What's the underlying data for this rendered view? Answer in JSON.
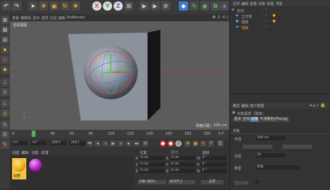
{
  "top_toolbar": {
    "axis_x": "X",
    "axis_y": "Y",
    "axis_z": "Z",
    "colors": {
      "accent": "#f5a623",
      "axis_x": "#e05050",
      "axis_y": "#50c050",
      "axis_z": "#5080e0"
    }
  },
  "viewport": {
    "menu_items": [
      "查看",
      "摄像机",
      "显示",
      "选项",
      "过滤",
      "面板",
      "ProRender"
    ],
    "view_label": "透视视图",
    "grid_spacing_label": "网格间距：",
    "grid_spacing_value": "100 cm"
  },
  "timeline": {
    "ticks": [
      "0",
      "20",
      "40",
      "60",
      "80",
      "100",
      "120",
      "140",
      "160",
      "180",
      "200"
    ],
    "current_frame": "0 F",
    "playhead_frame": 20
  },
  "playbar": {
    "start_field": "0 F",
    "min_field": "0 F",
    "end_field": "200 F",
    "max_field": "200 F"
  },
  "materials": {
    "tabs": [
      "创建",
      "编辑",
      "功能",
      "纹理"
    ],
    "items": [
      {
        "label": "材质",
        "color": "#f2b21c",
        "selected": true
      },
      {
        "label": "",
        "color": "#b020c0",
        "selected": false
      }
    ]
  },
  "coordinates": {
    "headers": [
      "位置",
      "尺寸",
      "旋转"
    ],
    "rows": [
      {
        "axis": "X",
        "pos": "0 cm",
        "size": "0 cm",
        "rot_axis": "H",
        "rot": "0 °"
      },
      {
        "axis": "Y",
        "pos": "0 cm",
        "size": "0 cm",
        "rot_axis": "P",
        "rot": "0 °"
      },
      {
        "axis": "Z",
        "pos": "0 cm",
        "size": "0 cm",
        "rot_axis": "B",
        "rot": "0 °"
      }
    ],
    "mode_select": "对象 (相对)",
    "size_select": "绝对尺寸",
    "apply_label": "应用"
  },
  "object_manager": {
    "menu_items": [
      "文件",
      "编辑",
      "查看",
      "对象",
      "标签",
      "书签"
    ],
    "objects": [
      {
        "name": "空白",
        "indent": 0,
        "icon_color": "#cccccc",
        "selected": false
      },
      {
        "name": "立方体",
        "indent": 1,
        "icon_color": "#5aa0e0",
        "selected": false
      },
      {
        "name": "球体",
        "indent": 1,
        "icon_color": "#5aa0e0",
        "selected": false
      },
      {
        "name": "地板",
        "indent": 1,
        "icon_color": "#5aa0e0",
        "selected": false
      }
    ]
  },
  "attribute_manager": {
    "menu_items": [
      "模式",
      "编辑",
      "用户数据"
    ],
    "title": "对象属性（球体）",
    "tabs": [
      "基本",
      "坐标",
      "对象",
      "平滑着色(Phong)"
    ],
    "section": "对象",
    "rows": [
      {
        "label": "半径",
        "value": "100 cm"
      },
      {
        "label": "分段",
        "value": "24"
      },
      {
        "label": "类型",
        "value": "标准"
      }
    ],
    "render_checkbox": "理想渲染",
    "buttons": [
      "",
      ""
    ]
  }
}
